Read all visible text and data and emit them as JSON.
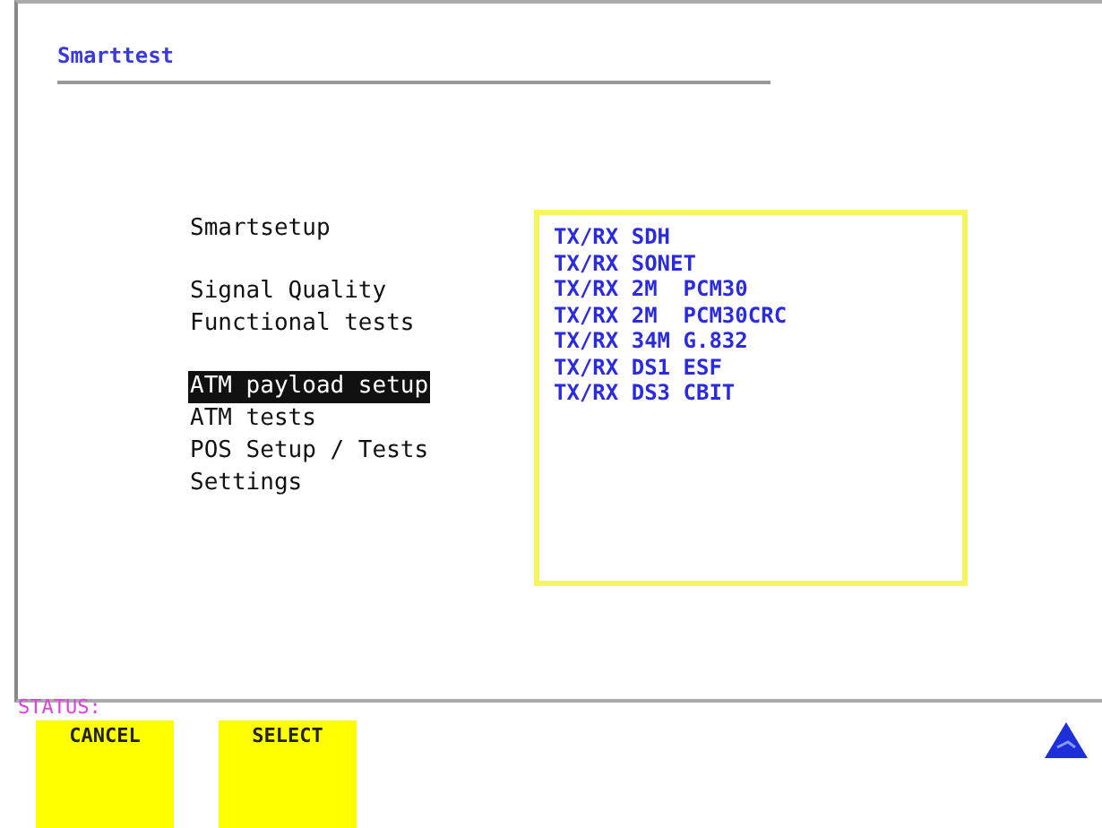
{
  "window": {
    "title": "Smarttest"
  },
  "menu": [
    {
      "items": [
        {
          "label": "Smartsetup",
          "selected": false
        }
      ]
    },
    {
      "items": [
        {
          "label": "Signal Quality",
          "selected": false
        },
        {
          "label": "Functional tests",
          "selected": false
        }
      ]
    },
    {
      "items": [
        {
          "label": "ATM payload setup",
          "selected": true
        },
        {
          "label": "ATM tests",
          "selected": false
        },
        {
          "label": "POS Setup / Tests",
          "selected": false
        },
        {
          "label": "Settings",
          "selected": false
        }
      ]
    }
  ],
  "options": [
    "TX/RX SDH",
    "TX/RX SONET",
    "TX/RX 2M  PCM30",
    "TX/RX 2M  PCM30CRC",
    "TX/RX 34M G.832",
    "TX/RX DS1 ESF",
    "TX/RX DS3 CBIT"
  ],
  "status": {
    "label": "STATUS:"
  },
  "softkeys": [
    "CANCEL",
    "SELECT"
  ]
}
